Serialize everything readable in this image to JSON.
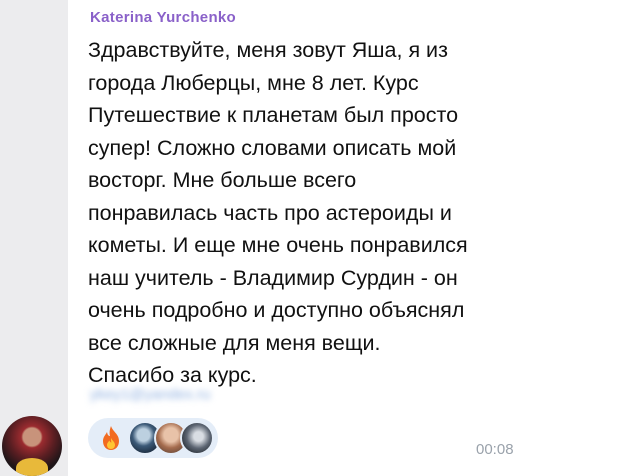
{
  "message": {
    "sender": "Katerina Yurchenko",
    "text": "Здравствуйте, меня зовут Яша, я из\nгорода Люберцы, мне 8 лет. Курс\nПутешествие к планетам был просто\nсупер! Сложно словами описать мой\nвосторг. Мне больше всего\nпонравилась часть про астероиды и\nкометы. И еще мне очень понравился\nнаш учитель - Владимир Сурдин - он\nочень подробно и доступно объяснял\nвсе сложные для меня вещи.\nСпасибо за курс.",
    "email_blurred": "ykey1@yandex.ru",
    "time": "00:08"
  },
  "reactions": {
    "emoji_icon": "fire-icon",
    "reactor_avatars": [
      "reactor-avatar-1",
      "reactor-avatar-2",
      "reactor-avatar-3"
    ]
  },
  "colors": {
    "sender": "#8a61c9",
    "reaction_pill": "#e4edf8",
    "time": "#9aa2ab",
    "background": "#ececee"
  }
}
